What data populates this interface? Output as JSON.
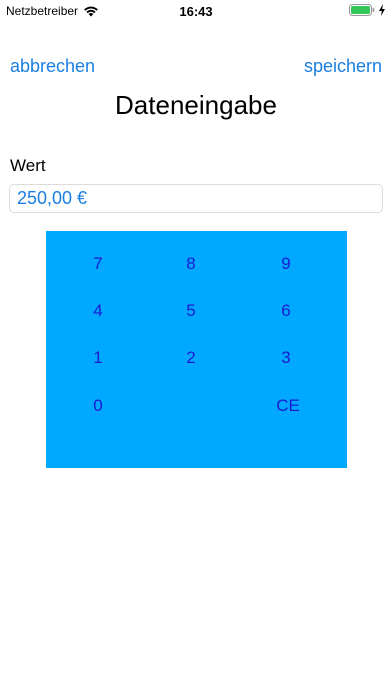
{
  "status_bar": {
    "carrier": "Netzbetreiber",
    "time": "16:43",
    "wifi_icon": "wifi-icon",
    "battery_icon": "battery-icon",
    "charging_icon": "bolt-icon",
    "battery_color": "#34c759"
  },
  "nav": {
    "cancel_label": "abbrechen",
    "save_label": "speichern",
    "title": "Dateneingabe",
    "link_color": "#1a7fe0"
  },
  "form": {
    "field_label": "Wert",
    "value": "250,00 €"
  },
  "keypad": {
    "background_color": "#00a8ff",
    "key_color": "#1c1ccf",
    "keys": {
      "k7": "7",
      "k8": "8",
      "k9": "9",
      "k4": "4",
      "k5": "5",
      "k6": "6",
      "k1": "1",
      "k2": "2",
      "k3": "3",
      "k0": "0",
      "clear": "CE"
    }
  }
}
